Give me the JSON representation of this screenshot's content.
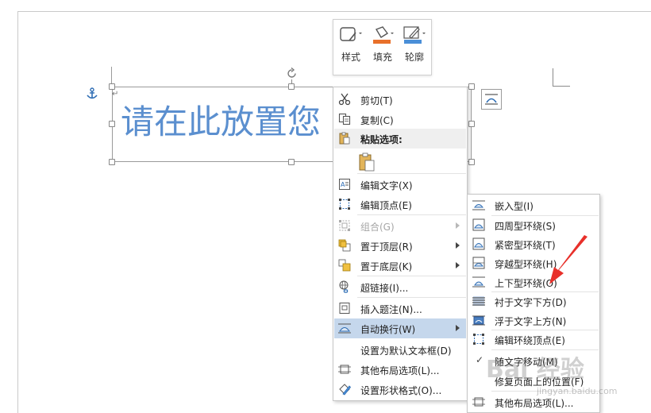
{
  "document": {
    "textbox_text": "请在此放置您",
    "paragraph_mark": "↵"
  },
  "mini_toolbar": {
    "style_label": "样式",
    "fill_label": "填充",
    "outline_label": "轮廓"
  },
  "context_menu": {
    "cut": "剪切(T)",
    "copy": "复制(C)",
    "paste_options": "粘贴选项:",
    "edit_text": "编辑文字(X)",
    "edit_points": "编辑顶点(E)",
    "group": "组合(G)",
    "bring_to_front": "置于顶层(R)",
    "send_to_back": "置于底层(K)",
    "hyperlink": "超链接(I)...",
    "insert_caption": "插入题注(N)...",
    "wrap_text": "自动换行(W)",
    "set_default_textbox": "设置为默认文本框(D)",
    "more_layout_options": "其他布局选项(L)...",
    "format_shape": "设置形状格式(O)..."
  },
  "wrap_submenu": {
    "in_line": "嵌入型(I)",
    "square": "四周型环绕(S)",
    "tight": "紧密型环绕(T)",
    "through": "穿越型环绕(H)",
    "top_bottom": "上下型环绕(O)",
    "behind_text": "衬于文字下方(D)",
    "in_front_of_text": "浮于文字上方(N)",
    "edit_wrap_points": "编辑环绕顶点(E)",
    "move_with_text": "随文字移动(M)",
    "fix_position": "修复页面上的位置(F)",
    "more_layout_options": "其他布局选项(L)..."
  },
  "watermark": {
    "brand": "Bai 经验",
    "site": "jingyan.baidu.com"
  },
  "colors": {
    "accent_text": "#5b8fcf",
    "highlight": "#c5d7ec",
    "annotation": "#e8302a",
    "fill_swatch": "#e8702a",
    "outline_swatch": "#4a8fd8"
  }
}
